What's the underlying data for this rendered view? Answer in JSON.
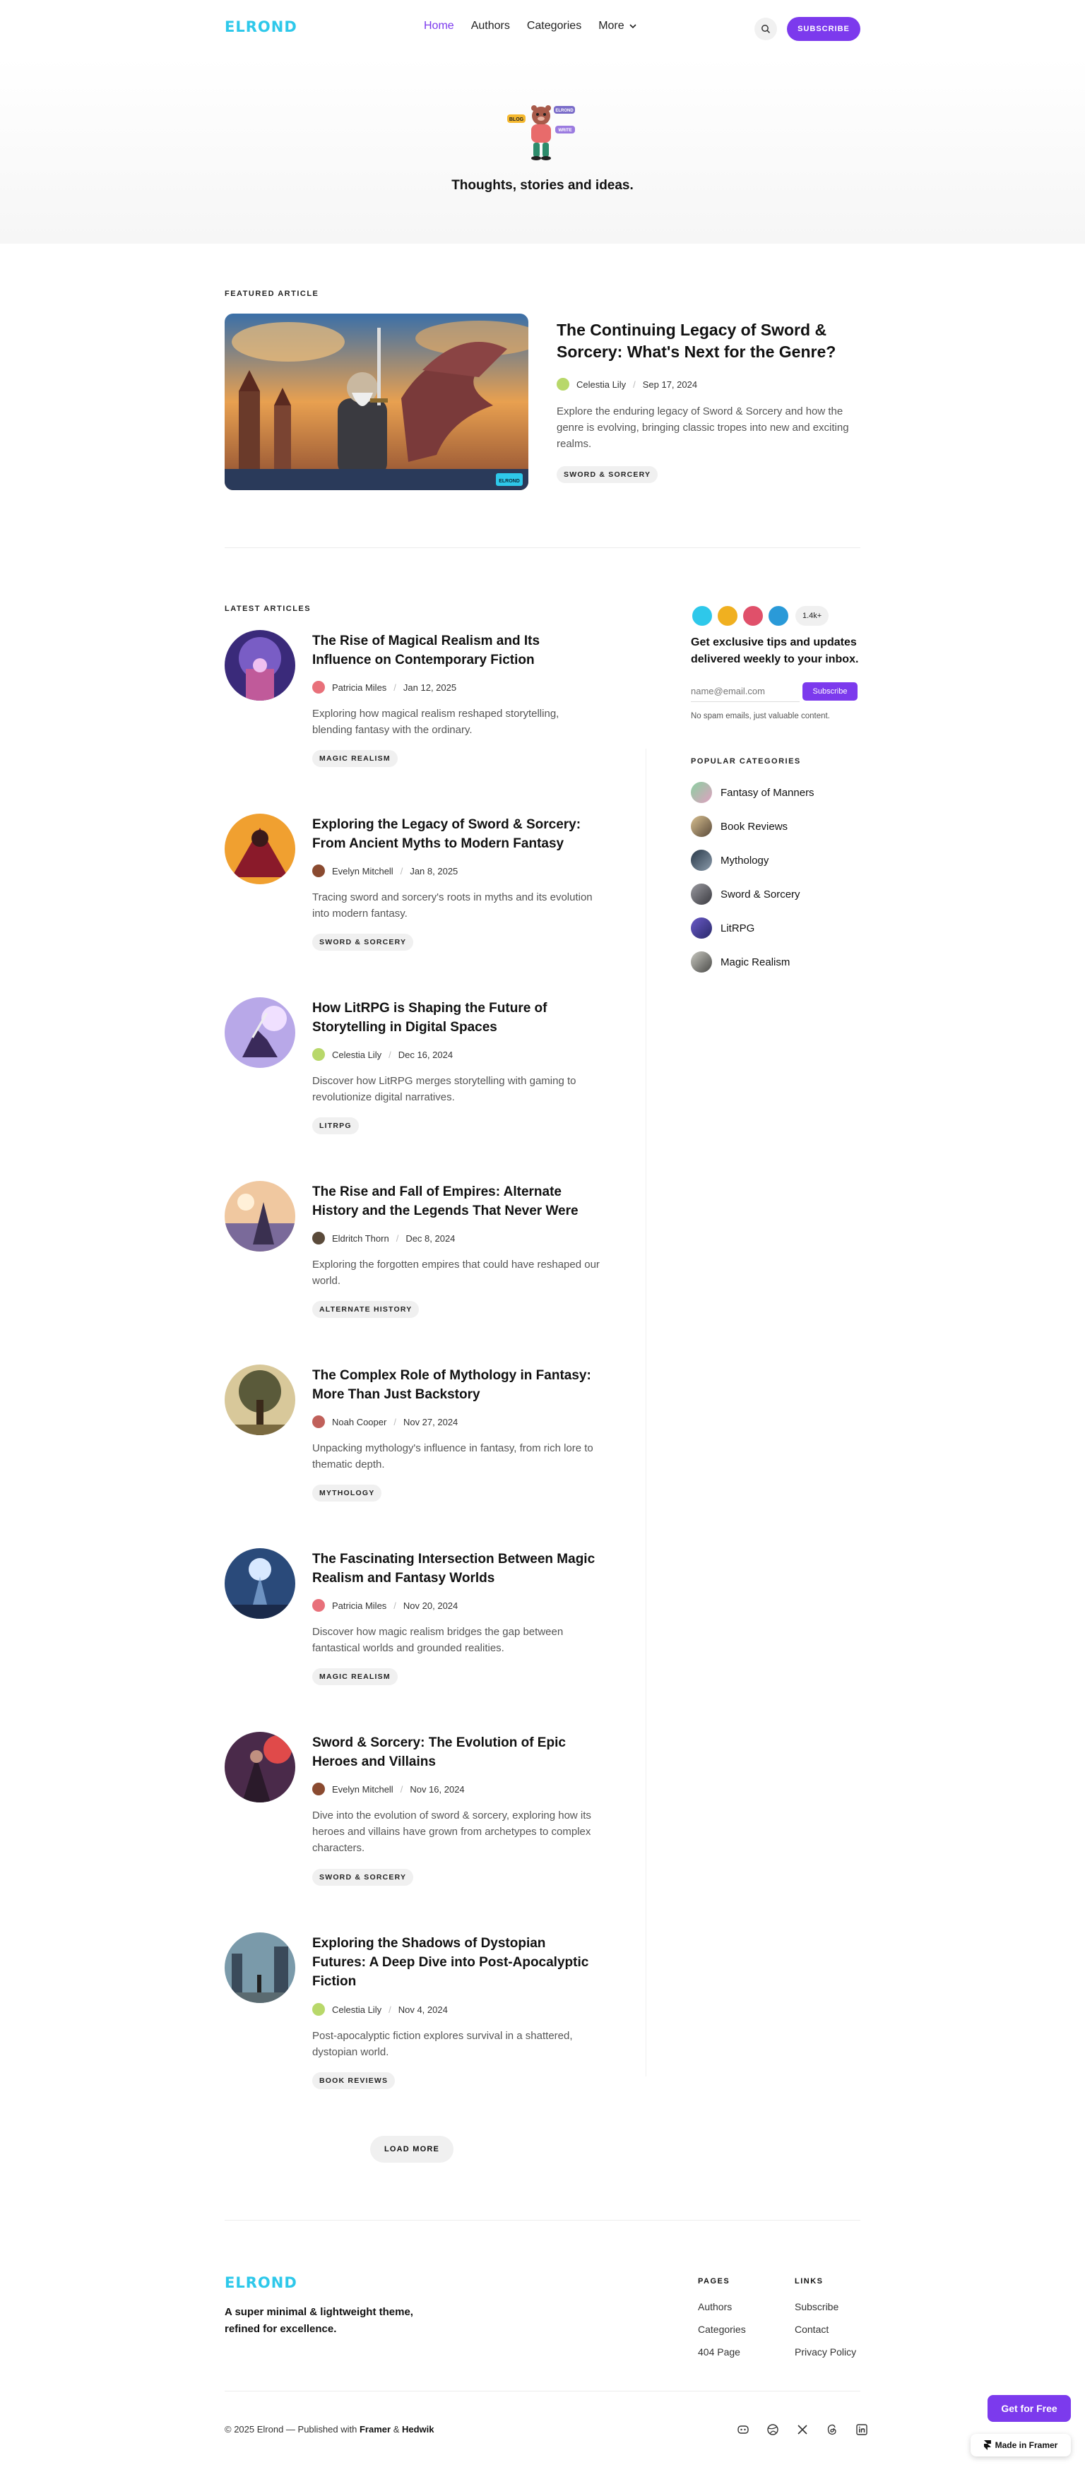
{
  "brand": {
    "logo_text": "ELROND",
    "accent": "#7c3aed",
    "logo_color": "#2ec8ea"
  },
  "nav": {
    "items": [
      {
        "label": "Home",
        "active": true
      },
      {
        "label": "Authors",
        "active": false
      },
      {
        "label": "Categories",
        "active": false
      },
      {
        "label": "More",
        "active": false
      }
    ],
    "search_icon": "search-icon",
    "subscribe_label": "SUBSCRIBE"
  },
  "hero": {
    "tagline": "Thoughts, stories and ideas.",
    "mascot_bubbles": [
      "BLOG",
      "ELROND",
      "WRITE"
    ]
  },
  "featured": {
    "section_label": "FEATURED ARTICLE",
    "title": "The Continuing Legacy of Sword & Sorcery: What's Next for the Genre?",
    "author": "Celestia Lily",
    "date": "Sep 17, 2024",
    "excerpt": "Explore the enduring legacy of Sword & Sorcery and how the genre is evolving, bringing classic tropes into new and exciting realms.",
    "tag": "SWORD & SORCERY",
    "image_badge": "ELROND"
  },
  "latest": {
    "section_label": "LATEST ARTICLES",
    "articles": [
      {
        "title": "The Rise of Magical Realism and Its Influence on Contemporary Fiction",
        "author": "Patricia Miles",
        "date": "Jan 12, 2025",
        "excerpt": "Exploring how magical realism reshaped storytelling, blending fantasy with the ordinary.",
        "tag": "MAGIC REALISM"
      },
      {
        "title": "Exploring the Legacy of Sword & Sorcery: From Ancient Myths to Modern Fantasy",
        "author": "Evelyn Mitchell",
        "date": "Jan 8, 2025",
        "excerpt": "Tracing sword and sorcery's roots in myths and its evolution into modern fantasy.",
        "tag": "SWORD & SORCERY"
      },
      {
        "title": "How LitRPG is Shaping the Future of Storytelling in Digital Spaces",
        "author": "Celestia Lily",
        "date": "Dec 16, 2024",
        "excerpt": "Discover how LitRPG merges storytelling with gaming to revolutionize digital narratives.",
        "tag": "LITRPG"
      },
      {
        "title": "The Rise and Fall of Empires: Alternate History and the Legends That Never Were",
        "author": "Eldritch Thorn",
        "date": "Dec 8, 2024",
        "excerpt": "Exploring the forgotten empires that could have reshaped our world.",
        "tag": "ALTERNATE HISTORY"
      },
      {
        "title": "The Complex Role of Mythology in Fantasy: More Than Just Backstory",
        "author": "Noah Cooper",
        "date": "Nov 27, 2024",
        "excerpt": "Unpacking mythology's influence in fantasy, from rich lore to thematic depth.",
        "tag": "MYTHOLOGY"
      },
      {
        "title": "The Fascinating Intersection Between Magic Realism and Fantasy Worlds",
        "author": "Patricia Miles",
        "date": "Nov 20, 2024",
        "excerpt": "Discover how magic realism bridges the gap between fantastical worlds and grounded realities.",
        "tag": "MAGIC REALISM"
      },
      {
        "title": "Sword & Sorcery: The Evolution of Epic Heroes and Villains",
        "author": "Evelyn Mitchell",
        "date": "Nov 16, 2024",
        "excerpt": "Dive into the evolution of sword & sorcery, exploring how its heroes and villains have grown from archetypes to complex characters.",
        "tag": "SWORD & SORCERY"
      },
      {
        "title": "Exploring the Shadows of Dystopian Futures: A Deep Dive into Post-Apocalyptic Fiction",
        "author": "Celestia Lily",
        "date": "Nov 4, 2024",
        "excerpt": "Post-apocalyptic fiction explores survival in a shattered, dystopian world.",
        "tag": "BOOK REVIEWS"
      }
    ],
    "load_more_label": "LOAD MORE"
  },
  "sidebar": {
    "subscriber_count": "1.4k+",
    "heading": "Get exclusive tips and updates delivered weekly to your inbox.",
    "email_placeholder": "name@email.com",
    "submit_label": "Subscribe",
    "note": "No spam emails, just valuable content.",
    "categories_label": "POPULAR CATEGORIES",
    "categories": [
      "Fantasy of Manners",
      "Book Reviews",
      "Mythology",
      "Sword & Sorcery",
      "LitRPG",
      "Magic Realism"
    ]
  },
  "footer": {
    "logo_text": "ELROND",
    "tagline": "A super minimal & lightweight theme, refined for excellence.",
    "pages_title": "PAGES",
    "pages": [
      "Authors",
      "Categories",
      "404 Page"
    ],
    "links_title": "LINKS",
    "links": [
      "Subscribe",
      "Contact",
      "Privacy Policy"
    ],
    "copyright_prefix": "© 2025 Elrond — Published with",
    "framer": "Framer",
    "amp": "&",
    "hedwik": "Hedwik",
    "socials": [
      "discord-icon",
      "dribbble-icon",
      "x-icon",
      "threads-icon",
      "linkedin-icon"
    ]
  },
  "framer_badge": {
    "get_free": "Get for Free",
    "made_in": "Made in Framer"
  }
}
